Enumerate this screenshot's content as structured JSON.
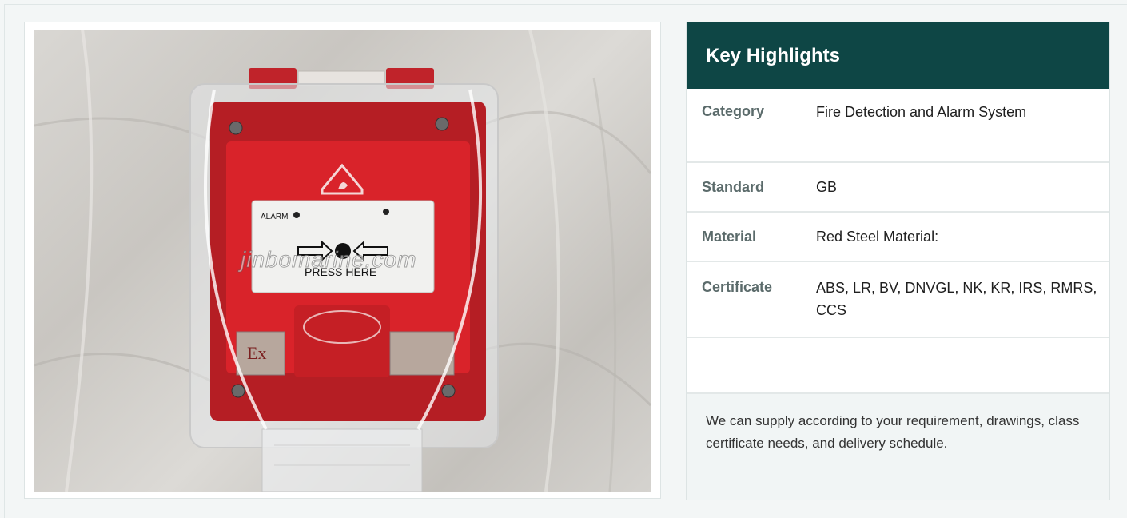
{
  "highlights": {
    "title": "Key Highlights",
    "rows": [
      {
        "label": "Category",
        "value": "Fire Detection and Alarm System"
      },
      {
        "label": "Standard",
        "value": "GB"
      },
      {
        "label": "Material",
        "value": "Red Steel Material:"
      },
      {
        "label": "Certificate",
        "value": "ABS, LR, BV, DNVGL, NK, KR, IRS, RMRS, CCS"
      }
    ],
    "note": "We can supply according to your requirement, drawings, class certificate needs, and delivery schedule."
  },
  "photo": {
    "watermark": "jinbomarine.com",
    "alarm_label": "ALARM",
    "press_label": "PRESS HERE",
    "ex_label": "Ex"
  },
  "colors": {
    "header_bg": "#0e4645",
    "device_red": "#d9232a"
  }
}
